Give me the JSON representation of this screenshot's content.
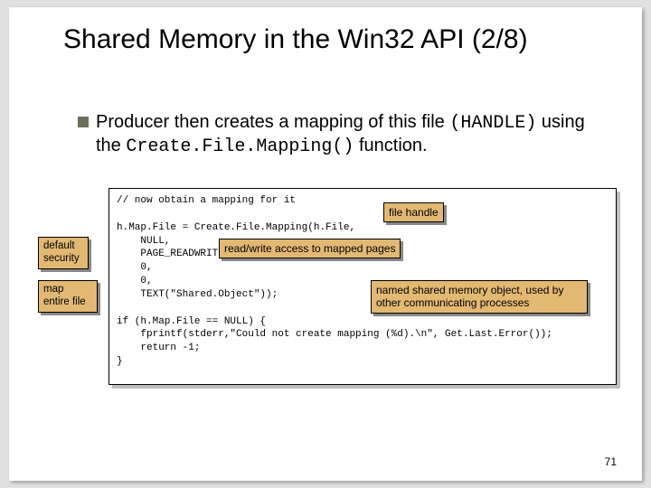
{
  "title": "Shared Memory in the Win32 API (2/8)",
  "bullet_prefix": "Producer then creates a mapping of this file ",
  "bullet_code1": "(HANDLE)",
  "bullet_mid": " using the ",
  "bullet_code2": "Create.File.Mapping()",
  "bullet_suffix": " function.",
  "code": "// now obtain a mapping for it\n\nh.Map.File = Create.File.Mapping(h.File,\n    NULL,\n    PAGE_READWRITE,\n    0,\n    0,\n    TEXT(\"Shared.Object\"));\n\nif (h.Map.File == NULL) {\n    fprintf(stderr,\"Could not create mapping (%d).\\n\", Get.Last.Error());\n    return -1;\n}",
  "labels": {
    "default_security": "default\nsecurity",
    "map_entire": "map entire\nfile",
    "file_handle": "file handle",
    "rw_access": "read/write access to mapped pages",
    "named_obj": "named shared memory object,\nused by other communicating processes"
  },
  "page_number": "71"
}
